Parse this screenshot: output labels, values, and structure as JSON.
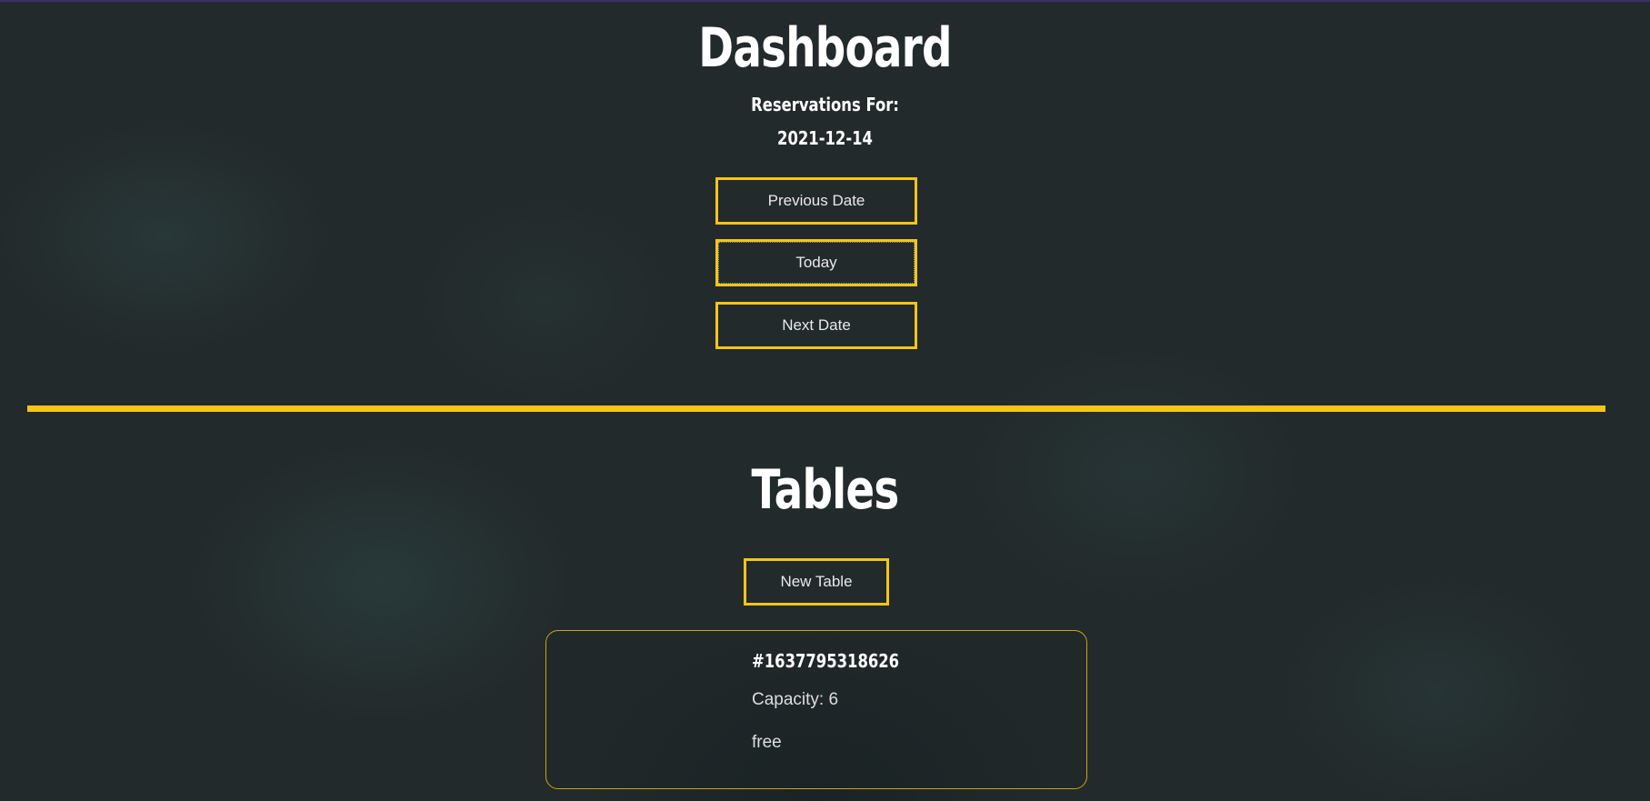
{
  "dashboard": {
    "title": "Dashboard",
    "reservations_label": "Reservations For:",
    "date": "2021-12-14",
    "buttons": {
      "previous": "Previous Date",
      "today": "Today",
      "next": "Next Date"
    }
  },
  "tables": {
    "title": "Tables",
    "new_table_label": "New Table",
    "items": [
      {
        "id": "#1637795318626",
        "capacity": "Capacity: 6",
        "status": "free"
      }
    ]
  },
  "colors": {
    "accent": "#f5c518",
    "background": "#232a2b",
    "text": "#ffffff"
  }
}
